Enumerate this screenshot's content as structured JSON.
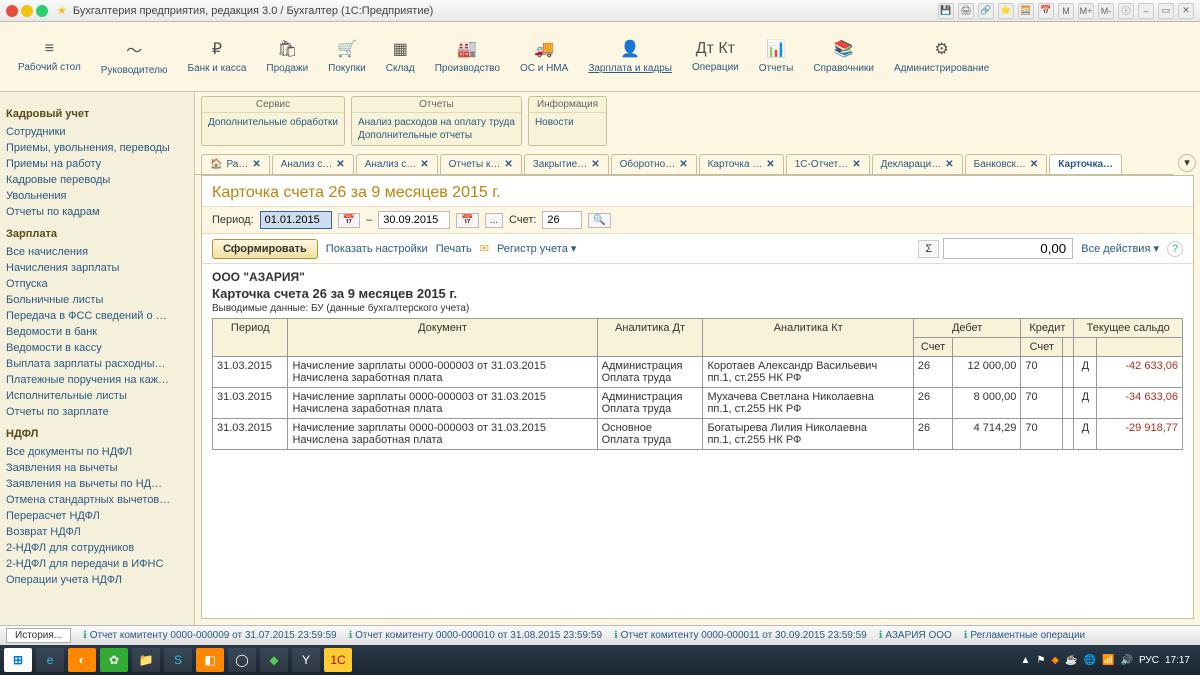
{
  "window_title": "Бухгалтерия предприятия, редакция 3.0 / Бухгалтер  (1С:Предприятие)",
  "ribbon": [
    {
      "icon": "≡",
      "label": "Рабочий стол"
    },
    {
      "icon": "～",
      "label": "Руководителю"
    },
    {
      "icon": "₽",
      "label": "Банк и касса"
    },
    {
      "icon": "🛍",
      "label": "Продажи"
    },
    {
      "icon": "🛒",
      "label": "Покупки"
    },
    {
      "icon": "▦",
      "label": "Склад"
    },
    {
      "icon": "🏭",
      "label": "Производство"
    },
    {
      "icon": "🚚",
      "label": "ОС и НМА"
    },
    {
      "icon": "👤",
      "label": "Зарплата и кадры",
      "active": true
    },
    {
      "icon": "Дт Кт",
      "label": "Операции"
    },
    {
      "icon": "📊",
      "label": "Отчеты"
    },
    {
      "icon": "📚",
      "label": "Справочники"
    },
    {
      "icon": "⚙",
      "label": "Администрирование"
    }
  ],
  "sidebar": {
    "sections": [
      {
        "title": "Кадровый учет",
        "links": [
          "Сотрудники",
          "Приемы, увольнения, переводы",
          "Приемы на работу",
          "Кадровые переводы",
          "Увольнения",
          "Отчеты по кадрам"
        ]
      },
      {
        "title": "Зарплата",
        "links": [
          "Все начисления",
          "Начисления зарплаты",
          "Отпуска",
          "Больничные листы",
          "Передача в ФСС сведений о …",
          "Ведомости в банк",
          "Ведомости в кассу",
          "Выплата зарплаты расходны…",
          "Платежные поручения на каж…",
          "Исполнительные листы",
          "Отчеты по зарплате"
        ]
      },
      {
        "title": "НДФЛ",
        "links": [
          "Все документы по НДФЛ",
          "Заявления на вычеты",
          "Заявления на вычеты по НД…",
          "Отмена стандартных вычетов…",
          "Перерасчет НДФЛ",
          "Возврат НДФЛ",
          "2-НДФЛ для сотрудников",
          "2-НДФЛ для передачи в ИФНС",
          "Операции учета НДФЛ"
        ]
      }
    ]
  },
  "groups": [
    {
      "title": "Сервис",
      "links": [
        "Дополнительные обработки"
      ]
    },
    {
      "title": "Отчеты",
      "links": [
        "Анализ расходов на оплату труда",
        "Дополнительные отчеты"
      ]
    },
    {
      "title": "Информация",
      "links": [
        "Новости"
      ]
    }
  ],
  "tabs": [
    "Ра…",
    "Анализ с…",
    "Анализ с…",
    "Отчеты к…",
    "Закрытие…",
    "Оборотно…",
    "Карточка …",
    "1С-Отчет…",
    "Деклараци…",
    "Банковск…",
    "Карточка…"
  ],
  "active_tab": 10,
  "content_title": "Карточка счета 26 за 9 месяцев 2015 г.",
  "period": {
    "label": "Период:",
    "from": "01.01.2015",
    "to": "30.09.2015",
    "separator": "–",
    "dots": "...",
    "account_label": "Счет:",
    "account": "26"
  },
  "toolbar": {
    "form": "Сформировать",
    "settings": "Показать настройки",
    "print": "Печать",
    "register": "Регистр учета ▾",
    "sum": "0,00",
    "all_actions": "Все действия ▾"
  },
  "report": {
    "org": "ООО \"АЗАРИЯ\"",
    "title": "Карточка счета 26 за 9 месяцев 2015 г.",
    "sub": "Выводимые данные:  БУ (данные бухгалтерского учета)",
    "headers": {
      "period": "Период",
      "doc": "Документ",
      "an_dt": "Аналитика Дт",
      "an_kt": "Аналитика Кт",
      "debit": "Дебет",
      "credit": "Кредит",
      "balance": "Текущее сальдо",
      "acct": "Счет"
    },
    "rows": [
      {
        "date": "31.03.2015",
        "doc": "Начисление зарплаты 0000-000003 от 31.03.2015\nНачислена заработная плата",
        "an_dt": "Администрация\nОплата труда",
        "an_kt": "Коротаев Александр Васильевич\nпп.1, ст.255 НК РФ",
        "d_acct": "26",
        "d_sum": "12 000,00",
        "c_acct": "70",
        "c_sum": "",
        "b_dk": "Д",
        "b_sum": "-42 633,06"
      },
      {
        "date": "31.03.2015",
        "doc": "Начисление зарплаты 0000-000003 от 31.03.2015\nНачислена заработная плата",
        "an_dt": "Администрация\nОплата труда",
        "an_kt": "Мухачева Светлана Николаевна\nпп.1, ст.255 НК РФ",
        "d_acct": "26",
        "d_sum": "8 000,00",
        "c_acct": "70",
        "c_sum": "",
        "b_dk": "Д",
        "b_sum": "-34 633,06"
      },
      {
        "date": "31.03.2015",
        "doc": "Начисление зарплаты 0000-000003 от 31.03.2015\nНачислена заработная плата",
        "an_dt": "Основное\nОплата труда",
        "an_kt": "Богатырева Лилия Николаевна\nпп.1, ст.255 НК РФ",
        "d_acct": "26",
        "d_sum": "4 714,29",
        "c_acct": "70",
        "c_sum": "",
        "b_dk": "Д",
        "b_sum": "-29 918,77"
      }
    ]
  },
  "status": {
    "history": "История...",
    "items": [
      "Отчет комитенту 0000-000009 от 31.07.2015 23:59:59",
      "Отчет комитенту 0000-000010 от 31.08.2015 23:59:59",
      "Отчет комитенту 0000-000011 от 30.09.2015 23:59:59",
      "АЗАРИЯ ООО",
      "Регламентные операции"
    ]
  },
  "tray": {
    "lang": "РУС",
    "time": "17:17"
  }
}
